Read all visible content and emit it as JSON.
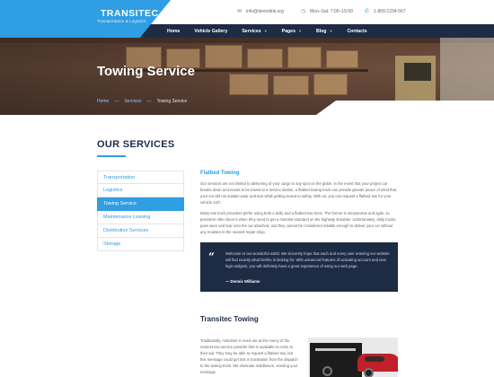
{
  "brand": {
    "name": "TRANSITEC",
    "tagline": "Transportation & Logistics",
    "accent_color": "#2f9ee2",
    "dark_color": "#1d2b45"
  },
  "contact": {
    "email": "info@demolink.org",
    "hours": "Mon–Sat: 7:00–15:00",
    "phone": "1-800-1234-567"
  },
  "nav": {
    "items": [
      {
        "label": "Home",
        "has_dropdown": false
      },
      {
        "label": "Vehicle Gallery",
        "has_dropdown": false
      },
      {
        "label": "Services",
        "has_dropdown": true
      },
      {
        "label": "Pages",
        "has_dropdown": true
      },
      {
        "label": "Blog",
        "has_dropdown": true
      },
      {
        "label": "Contacts",
        "has_dropdown": false
      }
    ]
  },
  "hero": {
    "title": "Towing Service",
    "breadcrumb": [
      "Home",
      "Services",
      "Towing Service"
    ]
  },
  "services": {
    "title": "OUR SERVICES",
    "items": [
      {
        "label": "Transportation",
        "active": false
      },
      {
        "label": "Logistics",
        "active": false
      },
      {
        "label": "Towing Service",
        "active": true
      },
      {
        "label": "Maintenance Leasing",
        "active": false
      },
      {
        "label": "Distribution Services",
        "active": false
      },
      {
        "label": "Storage",
        "active": false
      }
    ]
  },
  "content": {
    "heading": "Flatbed Towing",
    "para1": "Our services are not limited to delivering of your cargo to any spot on the globe. In the event that your project car breaks down and needs to be towed to a service station, a flatbed towing truck can provide greater peace of mind that your car will not sustain wear and tear while getting towed to safety. With us, you can request a flatbed tow for your vehicle 24/7.",
    "para2": "Many tow truck providers prefer using both a dolly and a flatbed tow truck. The former is inexpensive and agile, so providers often favor it when they need to get a motorist stranded on the highway shoulder. Unfortunately, dolly trucks pass wear and tear onto the car attached, and they cannot be considered reliable enough to deliver your car without any troubles to the nearest repair shop.",
    "quote": "Welcome to our wonderful world. We sincerely hope that each and every user entering our website will find exactly what he/she is looking for. With advanced features of activating account and new login widgets, you will definitely have a great experience of using our web page.",
    "quote_author": "— Dennis Williams",
    "heading2": "Transitec Towing",
    "para3": "Traditionally, motorists in need are at the mercy of the nearest tow service provider that is available to come to their aid. They may be able to request a flatbed tow, but this message could get lost in translation from the dispatch to the towing truck. We eliminate middlemen, sending your message"
  }
}
